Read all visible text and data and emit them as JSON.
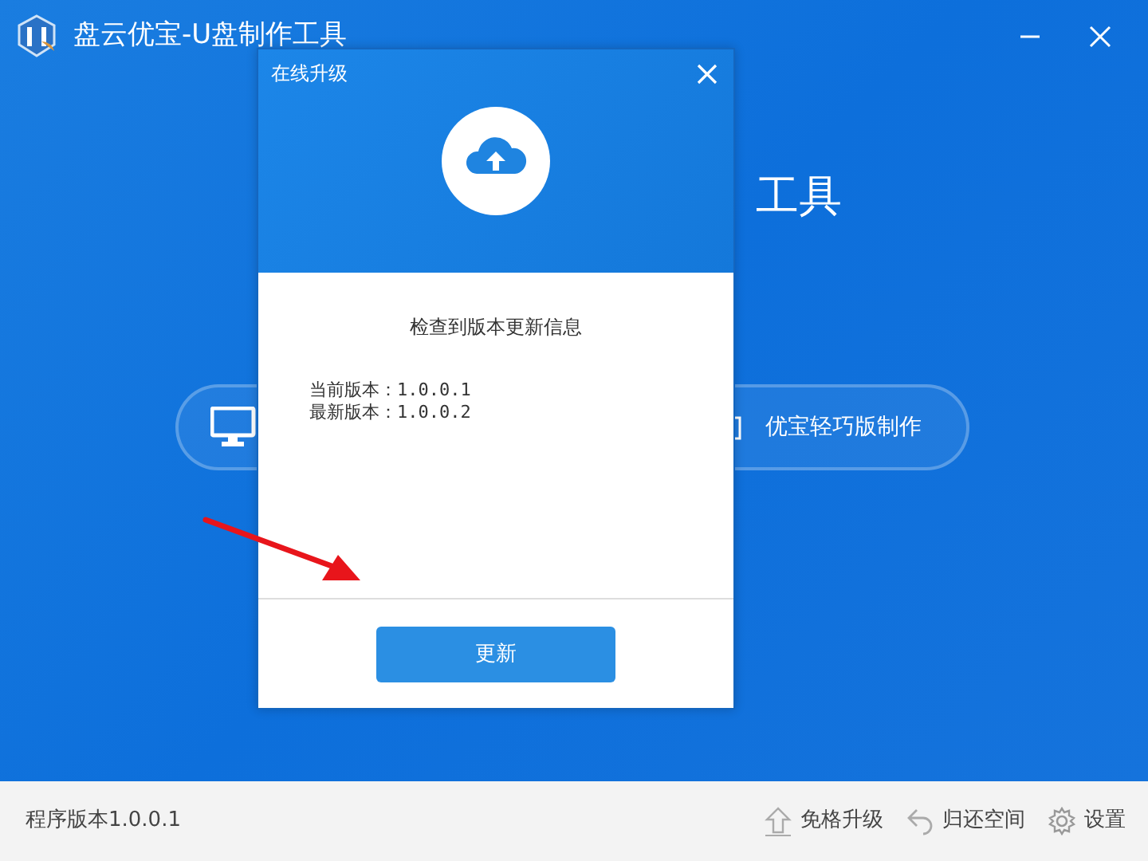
{
  "window": {
    "title": "盘云优宝-U盘制作工具"
  },
  "heading": "工具",
  "right_action": {
    "label": "优宝轻巧版制作"
  },
  "dialog": {
    "title": "在线升级",
    "message": "检查到版本更新信息",
    "lines": [
      "当前版本：1.0.0.1",
      "最新版本：1.0.0.2"
    ],
    "button": "更新"
  },
  "footer": {
    "version": "程序版本1.0.0.1",
    "links": [
      {
        "kind": "upgrade",
        "label": "免格升级"
      },
      {
        "kind": "restore",
        "label": "归还空间"
      },
      {
        "kind": "settings",
        "label": "设置"
      }
    ]
  }
}
